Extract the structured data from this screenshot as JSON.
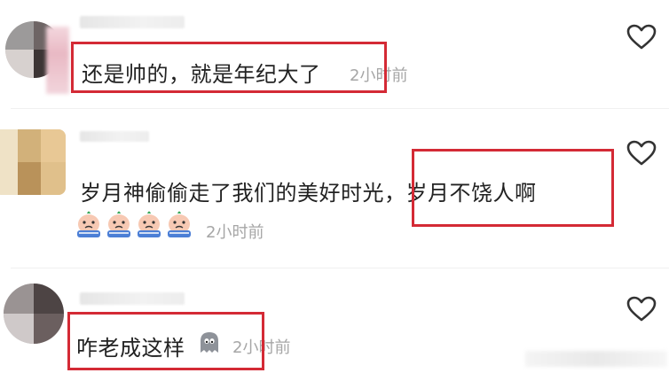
{
  "comments": [
    {
      "text": "还是帅的，就是年纪大了",
      "time": "2小时前",
      "highlight_color": "#d42a35"
    },
    {
      "text_before": "岁月神偷偷走了我们的美好时光，",
      "text_highlight": "岁月不饶人啊",
      "emoji": "crying-baby-emoji",
      "emoji_count": 4,
      "time": "2小时前",
      "highlight_color": "#d42a35"
    },
    {
      "text": "咋老成这样",
      "emoji": "gray-ghost-emoji",
      "time": "2小时前",
      "highlight_color": "#d42a35"
    }
  ],
  "icons": {
    "like": "heart-outline-icon"
  },
  "colors": {
    "text": "#222222",
    "time": "#a6a6a6",
    "highlight": "#d42a35",
    "icon": "#333333"
  }
}
